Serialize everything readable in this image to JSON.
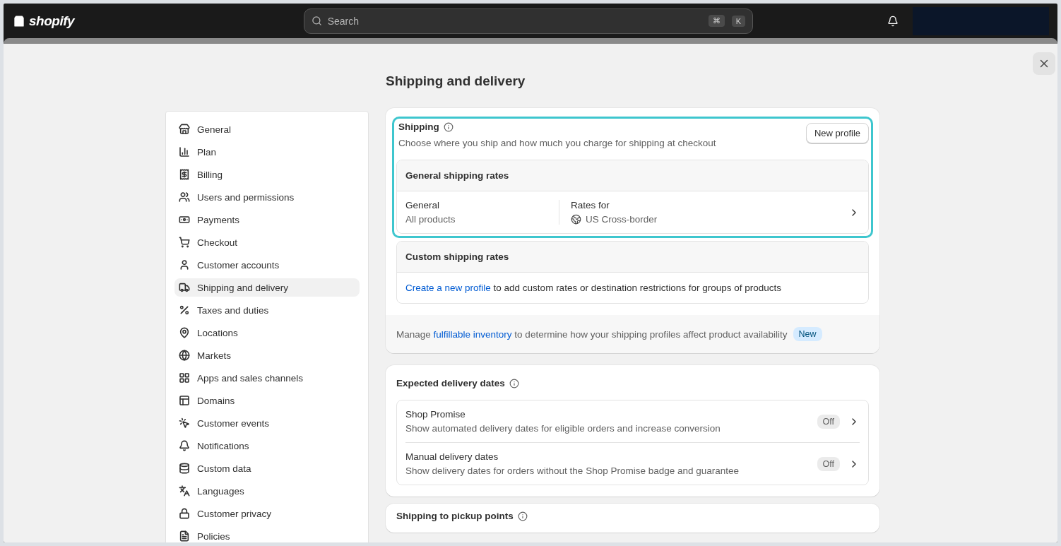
{
  "topbar": {
    "logo": "shopify",
    "search": {
      "placeholder": "Search",
      "keys": [
        "⌘",
        "K"
      ]
    }
  },
  "page_title": "Shipping and delivery",
  "sidebar": {
    "items": [
      {
        "label": "General",
        "selected": false
      },
      {
        "label": "Plan",
        "selected": false
      },
      {
        "label": "Billing",
        "selected": false
      },
      {
        "label": "Users and permissions",
        "selected": false
      },
      {
        "label": "Payments",
        "selected": false
      },
      {
        "label": "Checkout",
        "selected": false
      },
      {
        "label": "Customer accounts",
        "selected": false
      },
      {
        "label": "Shipping and delivery",
        "selected": true
      },
      {
        "label": "Taxes and duties",
        "selected": false
      },
      {
        "label": "Locations",
        "selected": false
      },
      {
        "label": "Markets",
        "selected": false
      },
      {
        "label": "Apps and sales channels",
        "selected": false
      },
      {
        "label": "Domains",
        "selected": false
      },
      {
        "label": "Customer events",
        "selected": false
      },
      {
        "label": "Notifications",
        "selected": false
      },
      {
        "label": "Custom data",
        "selected": false
      },
      {
        "label": "Languages",
        "selected": false
      },
      {
        "label": "Customer privacy",
        "selected": false
      },
      {
        "label": "Policies",
        "selected": false
      }
    ]
  },
  "shipping": {
    "title": "Shipping",
    "subtitle": "Choose where you ship and how much you charge for shipping at checkout",
    "highlighted": true,
    "button": "New profile",
    "general_rates": {
      "title": "General shipping rates",
      "profile_name": "General",
      "profile_scope": "All products",
      "rates_label": "Rates for",
      "zone": "US Cross-border"
    },
    "custom_rates": {
      "title": "Custom shipping rates",
      "link": "Create a new profile",
      "text": " to add custom rates or destination restrictions for groups of products"
    },
    "footer": {
      "before": "Manage ",
      "link": "fulfillable inventory",
      "after": " to determine how your shipping profiles affect product availability",
      "badge": "New"
    }
  },
  "delivery_dates": {
    "title": "Expected delivery dates",
    "items": [
      {
        "title": "Shop Promise",
        "description": "Show automated delivery dates for eligible orders and increase conversion",
        "status": "Off"
      },
      {
        "title": "Manual delivery dates",
        "description": "Show delivery dates for orders without the Shop Promise badge and guarantee",
        "status": "Off"
      }
    ]
  },
  "pickup": {
    "title": "Shipping to pickup points"
  }
}
